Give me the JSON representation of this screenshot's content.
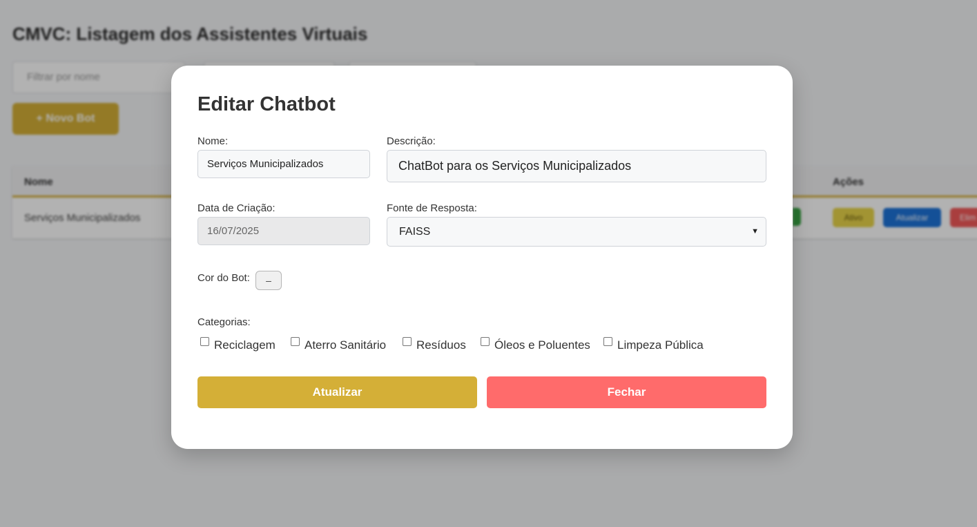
{
  "background": {
    "title": "CMVC: Listagem dos Assistentes Virtuais",
    "filter_placeholder": "Filtrar por nome",
    "new_bot_label": "+ Novo Bot",
    "table": {
      "headers": {
        "name": "Nome",
        "actions": "Ações"
      },
      "rows": [
        {
          "name": "Serviços Municipalizados",
          "actions": [
            "Ativo",
            "Atualizar",
            "Elim"
          ]
        }
      ]
    }
  },
  "modal": {
    "title": "Editar Chatbot",
    "fields": {
      "nome_label": "Nome:",
      "nome_value": "Serviços Municipalizados",
      "descricao_label": "Descrição:",
      "descricao_value": "ChatBot para os Serviços Municipalizados",
      "data_label": "Data de Criação:",
      "data_value": "16/07/2025",
      "fonte_label": "Fonte de Resposta:",
      "fonte_value": "FAISS",
      "cor_label": "Cor do Bot:",
      "cor_button": "–",
      "categorias_label": "Categorias:"
    },
    "categories": [
      {
        "label": "Reciclagem",
        "checked": false
      },
      {
        "label": "Aterro Sanitário",
        "checked": false
      },
      {
        "label": "Resíduos",
        "checked": false
      },
      {
        "label": "Óleos e Poluentes",
        "checked": false
      },
      {
        "label": "Limpeza Pública",
        "checked": false
      }
    ],
    "buttons": {
      "update": "Atualizar",
      "close": "Fechar"
    }
  },
  "colors": {
    "accent": "#d4af37",
    "close": "#ff6b6b"
  }
}
